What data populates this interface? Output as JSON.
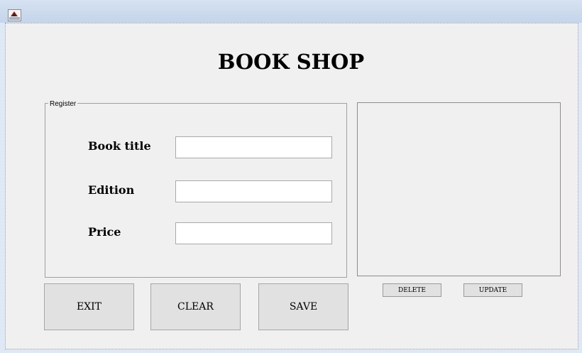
{
  "window": {
    "icon": "app-form-icon"
  },
  "page": {
    "title": "BOOK SHOP"
  },
  "register": {
    "legend": "Register",
    "fields": [
      {
        "label": "Book title",
        "value": ""
      },
      {
        "label": "Edition",
        "value": ""
      },
      {
        "label": "Price",
        "value": ""
      }
    ]
  },
  "list": {
    "items": []
  },
  "list_actions": {
    "delete_label": "DELETE",
    "update_label": "UPDATE"
  },
  "actions": {
    "exit_label": "EXIT",
    "clear_label": "CLEAR",
    "save_label": "SAVE"
  }
}
